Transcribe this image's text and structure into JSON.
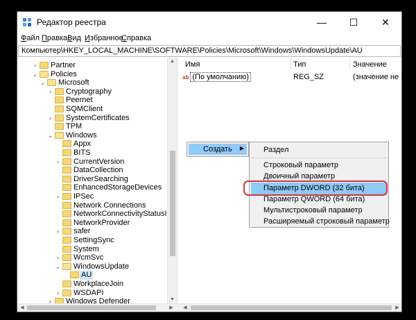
{
  "window": {
    "title": "Редактор реестра",
    "controls": {
      "minimize": "—",
      "maximize": "☐",
      "close": "✕"
    }
  },
  "menu": [
    {
      "ul": "Ф",
      "rest": "айл"
    },
    {
      "ul": "П",
      "rest": "равка"
    },
    {
      "ul": "В",
      "rest": "ид"
    },
    {
      "ul": "И",
      "rest": "збранное"
    },
    {
      "ul": "С",
      "rest": "правка"
    }
  ],
  "address": "Компьютер\\HKEY_LOCAL_MACHINE\\SOFTWARE\\Policies\\Microsoft\\Windows\\WindowsUpdate\\AU",
  "tree": [
    {
      "label": "Partner",
      "chev": "›",
      "depth": 0
    },
    {
      "label": "Policies",
      "chev": "⌄",
      "depth": 0
    },
    {
      "label": "Microsoft",
      "chev": "⌄",
      "depth": 1
    },
    {
      "label": "Cryptography",
      "chev": "›",
      "depth": 2
    },
    {
      "label": "Peernet",
      "chev": "",
      "depth": 2
    },
    {
      "label": "SQMClient",
      "chev": "",
      "depth": 2
    },
    {
      "label": "SystemCertificates",
      "chev": "›",
      "depth": 2
    },
    {
      "label": "TPM",
      "chev": "",
      "depth": 2
    },
    {
      "label": "Windows",
      "chev": "⌄",
      "depth": 2
    },
    {
      "label": "Appx",
      "chev": "",
      "depth": 3
    },
    {
      "label": "BITS",
      "chev": "",
      "depth": 3
    },
    {
      "label": "CurrentVersion",
      "chev": "›",
      "depth": 3
    },
    {
      "label": "DataCollection",
      "chev": "",
      "depth": 3
    },
    {
      "label": "DriverSearching",
      "chev": "",
      "depth": 3
    },
    {
      "label": "EnhancedStorageDevices",
      "chev": "",
      "depth": 3
    },
    {
      "label": "IPSec",
      "chev": "›",
      "depth": 3
    },
    {
      "label": "Network Connections",
      "chev": "",
      "depth": 3
    },
    {
      "label": "NetworkConnectivityStatusIndicator",
      "chev": "",
      "depth": 3
    },
    {
      "label": "NetworkProvider",
      "chev": "",
      "depth": 3
    },
    {
      "label": "safer",
      "chev": "›",
      "depth": 3
    },
    {
      "label": "SettingSync",
      "chev": "",
      "depth": 3
    },
    {
      "label": "System",
      "chev": "",
      "depth": 3
    },
    {
      "label": "WcmSvc",
      "chev": "›",
      "depth": 3
    },
    {
      "label": "WindowsUpdate",
      "chev": "⌄",
      "depth": 3
    },
    {
      "label": "AU",
      "chev": "",
      "depth": 4,
      "selected": true
    },
    {
      "label": "WorkplaceJoin",
      "chev": "",
      "depth": 3
    },
    {
      "label": "WSDAPI",
      "chev": "›",
      "depth": 3
    },
    {
      "label": "Windows Defender",
      "chev": "›",
      "depth": 2
    }
  ],
  "columns": {
    "name": "Имя",
    "type": "Тип",
    "value": "Значение"
  },
  "values": [
    {
      "name": "(По умолчанию)",
      "type": "REG_SZ",
      "data": "(значение не при"
    }
  ],
  "context_menu": {
    "create": "Создать",
    "submenu": [
      "Раздел",
      "Строковый параметр",
      "Двоичный параметр",
      "Параметр DWORD (32 бита)",
      "Параметр QWORD (64 бита)",
      "Мультистроковый параметр",
      "Расширяемый строковый параметр"
    ]
  },
  "colors": {
    "highlight": "#91c9f7",
    "annotation_ring": "#d0383b"
  }
}
